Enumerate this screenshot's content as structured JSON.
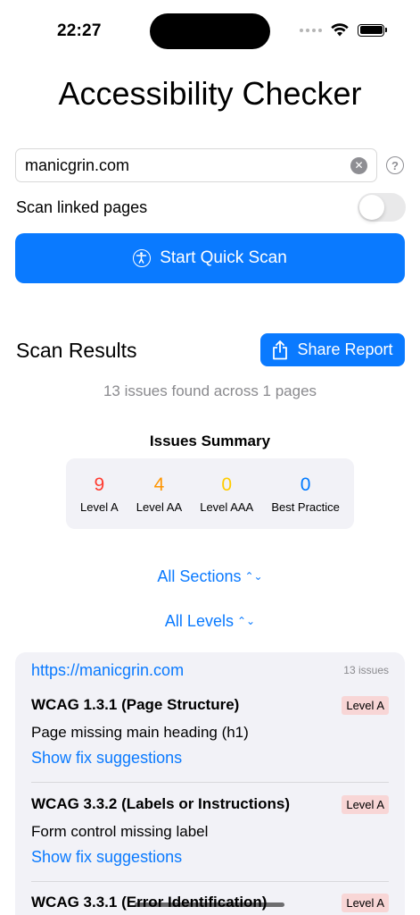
{
  "status_bar": {
    "time": "22:27"
  },
  "app": {
    "title": "Accessibility Checker"
  },
  "url_input": {
    "value": "manicgrin.com",
    "placeholder": ""
  },
  "toggle": {
    "label": "Scan linked pages",
    "on": false
  },
  "scan_button": {
    "label": "Start Quick Scan"
  },
  "results": {
    "title": "Scan Results",
    "share_label": "Share Report",
    "summary_text": "13 issues found across 1 pages"
  },
  "summary": {
    "title": "Issues Summary",
    "items": [
      {
        "count": "9",
        "label": "Level A",
        "color": "#ff3b30"
      },
      {
        "count": "4",
        "label": "Level AA",
        "color": "#ff9500"
      },
      {
        "count": "0",
        "label": "Level AAA",
        "color": "#ffcc00"
      },
      {
        "count": "0",
        "label": "Best Practice",
        "color": "#007aff"
      }
    ]
  },
  "filters": {
    "sections": "All Sections",
    "levels": "All Levels"
  },
  "page_group": {
    "url": "https://manicgrin.com",
    "count": "13 issues",
    "issues": [
      {
        "title": "WCAG 1.3.1 (Page Structure)",
        "level": "Level A",
        "description": "Page missing main heading (h1)",
        "fix": "Show fix suggestions"
      },
      {
        "title": "WCAG 3.3.2 (Labels or Instructions)",
        "level": "Level A",
        "description": "Form control missing label",
        "fix": "Show fix suggestions"
      },
      {
        "title": "WCAG 3.3.1 (Error Identification)",
        "level": "Level A",
        "description": "",
        "fix": ""
      }
    ]
  },
  "colors": {
    "accent": "#0a7aff",
    "badge_bg": "#f8d6d6",
    "card_bg": "#f2f2f7"
  }
}
